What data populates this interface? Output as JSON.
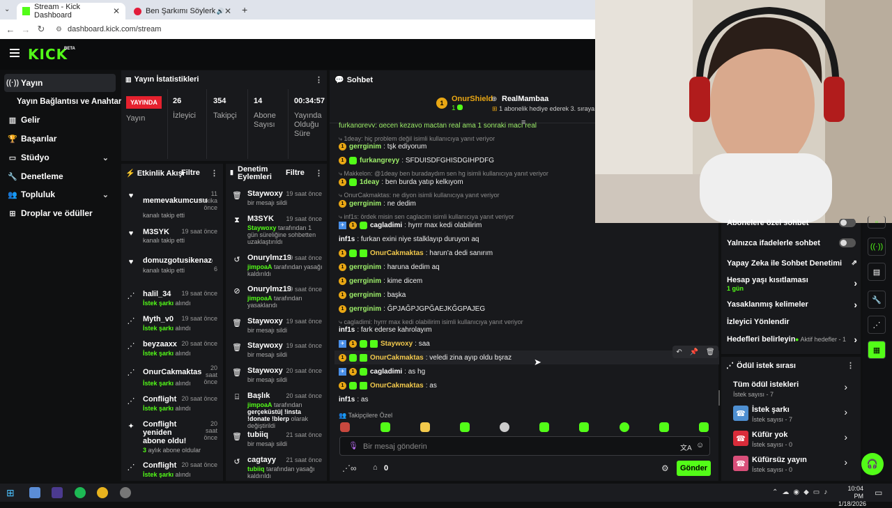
{
  "browser": {
    "tabs": [
      {
        "label": "Stream - Kick Dashboard"
      },
      {
        "label": "Ben Şarkımı Söylerken - You"
      }
    ],
    "url": "dashboard.kick.com/stream"
  },
  "colors": {
    "accent": "#53fc18",
    "live": "#e5212e",
    "panel": "#18191c"
  },
  "logo": {
    "text": "KICK",
    "badge": "BETA"
  },
  "nav": {
    "items": [
      {
        "label": "Yayın",
        "icon": "broadcast-icon"
      },
      {
        "label": "Yayın Bağlantısı ve Anahtarı",
        "icon": ""
      },
      {
        "label": "Gelir",
        "icon": "chart-icon"
      },
      {
        "label": "Başarılar",
        "icon": "trophy-icon"
      },
      {
        "label": "Stüdyo",
        "icon": "monitor-icon"
      },
      {
        "label": "Denetleme",
        "icon": "wrench-icon"
      },
      {
        "label": "Topluluk",
        "icon": "people-icon"
      },
      {
        "label": "Droplar ve ödüller",
        "icon": "gift-icon"
      }
    ]
  },
  "stats": {
    "title": "Yayın İstatistikleri",
    "live_badge": "YAYINDA",
    "live_label": "Yayın",
    "viewers_value": "26",
    "viewers_label": "İzleyici",
    "followers_value": "354",
    "followers_label": "Takipçi",
    "subs_value": "14",
    "subs_label_1": "Abone",
    "subs_label_2": "Sayısı",
    "uptime_value": "00:34:57",
    "uptime_label_1": "Yayında",
    "uptime_label_2": "Olduğu",
    "uptime_label_3": "Süre"
  },
  "activity": {
    "title": "Etkinlik Akışı",
    "filter": "Filtre",
    "events": [
      {
        "name": "memevakumcusu",
        "time": "11 dakika önce",
        "sub": "kanalı takip etti",
        "hl": ""
      },
      {
        "name": "M3SYK",
        "time": "19 saat önce",
        "sub": "kanalı takip etti",
        "hl": ""
      },
      {
        "name": "domuzgotusikenazgin",
        "time": "6",
        "sub": "kanalı takip etti",
        "hl": ""
      },
      {
        "name": "halil_34",
        "time": "19 saat önce",
        "hl": "İstek şarkı",
        "sub": " alındı"
      },
      {
        "name": "Myth_v0",
        "time": "19 saat önce",
        "hl": "İstek şarkı",
        "sub": " alındı"
      },
      {
        "name": "beyzaaxx",
        "time": "20 saat önce",
        "hl": "İstek şarkı",
        "sub": " alındı"
      },
      {
        "name": "OnurCakmaktas",
        "time": "20 saat önce",
        "hl": "İstek şarkı",
        "sub": " alındı"
      },
      {
        "name": "Conflight",
        "time": "20 saat önce",
        "hl": "İstek şarkı",
        "sub": " alındı"
      },
      {
        "name": "Conflight yeniden abone oldu!",
        "time": "20 saat önce",
        "hl": "3",
        "sub": " aylık abone oldular"
      },
      {
        "name": "Conflight",
        "time": "20 saat önce",
        "hl": "İstek şarkı",
        "sub": " alındı"
      }
    ]
  },
  "modlog": {
    "title_1": "Denetim",
    "title_2": "Eylemleri",
    "filter": "Filtre",
    "items": [
      {
        "name": "Staywoxy",
        "time": "19 saat önce",
        "sub": "bir mesajı sildi"
      },
      {
        "name": "M3SYK",
        "time": "19 saat önce",
        "actor": "Staywoxy",
        "sub": " tarafından 1 gün süreliğine sohbetten uzaklaştırıldı"
      },
      {
        "name": "Onurylmz19",
        "time": "19 saat önce",
        "actor": "jimpoaA",
        "sub": " tarafından yasağı kaldırıldı"
      },
      {
        "name": "Onurylmz19",
        "time": "19 saat önce",
        "actor": "jimpoaA",
        "sub": " tarafından yasaklandı"
      },
      {
        "name": "Staywoxy",
        "time": "19 saat önce",
        "sub": "bir mesajı sildi"
      },
      {
        "name": "Staywoxy",
        "time": "19 saat önce",
        "sub": "bir mesajı sildi"
      },
      {
        "name": "Staywoxy",
        "time": "20 saat önce",
        "sub": "bir mesajı sildi"
      },
      {
        "name": "Başlık",
        "time": "20 saat önce",
        "actor": "jimpoaA",
        "sub": " tarafından",
        "bold": "gerçeküstü| !insta !donate !blerp",
        "sub2": " olarak değiştirildi"
      },
      {
        "name": "tubiiq",
        "time": "21 saat önce",
        "sub": "bir mesajı sildi"
      },
      {
        "name": "cagtayy",
        "time": "21 saat önce",
        "actor": "tubiiq",
        "sub": " tarafından yasağı kaldırıldı"
      }
    ]
  },
  "chat": {
    "title": "Sohbet",
    "pinned_user": "OnurShield",
    "pinned_count": "1",
    "gift_user": "RealMambaa",
    "gift_text": "1 abonelik hediye ederek 3. sıraya y",
    "top_cut": "furkangreyy: geçen kezayo maçtan real ama 1 sonraki maçı real",
    "messages": [
      {
        "reply": "1deay: hiç problem değil isimli kullanıcıya yanıt veriyor",
        "user": "gerrginim",
        "text": "tşk ediyorum",
        "color": "#9ef06a",
        "badges": "b"
      },
      {
        "user": "furkangreyy",
        "text": "SFDUISDFGHISDGIHPDFG",
        "color": "#9ef06a",
        "badges": "bs"
      },
      {
        "reply": "Makkelon: @1deay ben buradaydım sen hg isimli kullanıcıya yanıt veriyor",
        "user": "1deay",
        "text": "ben burda yatıp kelkıyom",
        "color": "#9ef06a",
        "badges": "bs"
      },
      {
        "reply": "OnurCakmaktas: ne diyon isimli kullanıcıya yanıt veriyor",
        "user": "gerrginim",
        "text": "ne dedim",
        "color": "#9ef06a",
        "badges": "b"
      },
      {
        "reply": "inf1s: ördek misin sen caglacim isimli kullanıcıya yanıt veriyor",
        "user": "cagladimi",
        "text": "hyrrr max kedi olabilirim",
        "color": "#ffffff",
        "badges": "vbs"
      },
      {
        "user": "inf1s",
        "text": "furkan exini niye stalklayıp duruyon aq",
        "color": "#ffffff",
        "badges": ""
      },
      {
        "user": "OnurCakmaktas",
        "text": "harun'a dedi sanırım",
        "color": "#f2c94c",
        "badges": "bsg"
      },
      {
        "user": "gerrginim",
        "text": "haruna dedim aq",
        "color": "#9ef06a",
        "badges": "b"
      },
      {
        "user": "gerrginim",
        "text": "kime dicem",
        "color": "#9ef06a",
        "badges": "b"
      },
      {
        "user": "gerrginim",
        "text": "başka",
        "color": "#9ef06a",
        "badges": "b"
      },
      {
        "user": "gerrginim",
        "text": "ĞPJAĞPJGPĞAEJKĞGPAJEG",
        "color": "#9ef06a",
        "badges": "b"
      },
      {
        "reply": "cagladimi: hyrrr max kedi olabilirim isimli kullanıcıya yanıt veriyor",
        "user": "inf1s",
        "text": "fark ederse kahrolayım",
        "color": "#ffffff",
        "badges": ""
      },
      {
        "user": "Staywoxy",
        "text": "saa",
        "color": "#f2c94c",
        "badges": "vbsg"
      },
      {
        "user": "OnurCakmaktas",
        "text": "veledi zina ayıp oldu bşraz",
        "color": "#f2c94c",
        "badges": "bsg"
      },
      {
        "user": "cagladimi",
        "text": "as hg",
        "color": "#ffffff",
        "badges": "vbs"
      },
      {
        "user": "OnurCakmaktas",
        "text": "as",
        "color": "#f2c94c",
        "badges": "bsg"
      },
      {
        "user": "inf1s",
        "text": "as",
        "color": "#ffffff",
        "badges": ""
      }
    ],
    "followers_only": "Takipçilere Özel",
    "input_placeholder": "Bir mesaj gönderin",
    "points": "0",
    "send": "Gönder"
  },
  "settings": {
    "items": [
      {
        "label": "Abonelere özel sohbet",
        "type": "toggle"
      },
      {
        "label": "Yalnızca ifadelerle sohbet",
        "type": "toggle"
      },
      {
        "label": "Yapay Zeka ile Sohbet Denetimi",
        "type": "external"
      },
      {
        "label": "Hesap yaşı kısıtlaması",
        "sub": "1 gün",
        "type": "arrow"
      },
      {
        "label": "Yasaklanmış kelimeler",
        "type": "arrow"
      },
      {
        "label": "İzleyici Yönlendir",
        "type": "none"
      },
      {
        "label": "Hedefleri belirleyin",
        "status": "Aktif hedefler - 1",
        "type": "arrow"
      }
    ]
  },
  "rewards": {
    "title": "Ödül istek sırası",
    "items": [
      {
        "label": "Tüm ödül istekleri",
        "count": "İstek sayısı - 7",
        "icon": ""
      },
      {
        "label": "İstek şarkı",
        "count": "İstek sayısı - 7",
        "icon": "phone-icon"
      },
      {
        "label": "Küfür yok",
        "count": "İstek sayısı - 0",
        "icon": "phone-icon"
      },
      {
        "label": "Küfürsüz yayın",
        "count": "İstek sayısı - 0",
        "icon": "phone-icon"
      }
    ]
  },
  "taskbar": {
    "time": "10:04 PM",
    "date": "1/18/2026"
  }
}
